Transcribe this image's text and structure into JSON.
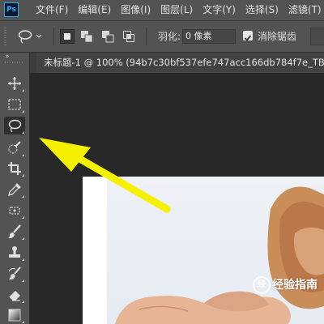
{
  "app": {
    "logo_text": "Ps"
  },
  "menu": [
    "文件(F)",
    "编辑(E)",
    "图像(I)",
    "图层(L)",
    "文字(Y)",
    "选择(S)",
    "滤镜(T)"
  ],
  "options_bar": {
    "feather_label": "羽化:",
    "feather_value": "0 像素",
    "anti_alias_label": "消除锯齿",
    "anti_alias_checked": true
  },
  "toolbar": {
    "collapse_glyph": "»",
    "tools": [
      "move-icon",
      "marquee-icon",
      "lasso-icon",
      "quick-selection-icon",
      "crop-icon",
      "eyedropper-icon",
      "spot-healing-icon",
      "brush-icon",
      "clone-stamp-icon",
      "history-brush-icon",
      "eraser-icon",
      "gradient-icon"
    ],
    "active_tool": "lasso-icon"
  },
  "document_tab": {
    "title": "未标题-1 @ 100% (94b7c30bf537efe747acc166db784f7e_TB27Kmc"
  },
  "annotation": {
    "arrow_color": "#f5f000"
  },
  "watermark": {
    "logo_text": "经",
    "text": "经验指南"
  },
  "colors": {
    "ui_panel": "#535353",
    "workspace": "#282828",
    "accent": "#31a8ff"
  }
}
